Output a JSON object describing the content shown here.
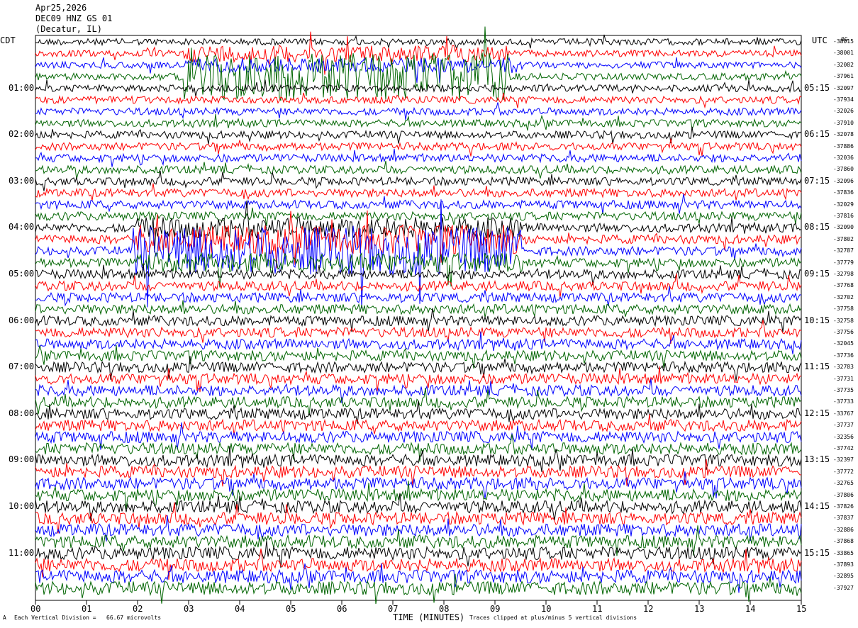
{
  "header": {
    "date": "Apr25,2026",
    "station": "DEC09 HNZ GS 01",
    "location": "(Decatur, IL)"
  },
  "left_tz": "CDT",
  "right_tz": "UTC",
  "right_tz_sub": "0G",
  "footer": {
    "scale": "Each Vertical Division =   66.67 microvolts",
    "clip": "Traces clipped at plus/minus 5 vertical divisions",
    "mark": "A"
  },
  "chart_data": {
    "type": "line",
    "title": "",
    "xlabel": "TIME (MINUTES)",
    "ylabel": "",
    "xlim": [
      0,
      15
    ],
    "x_ticks": [
      "00",
      "01",
      "02",
      "03",
      "04",
      "05",
      "06",
      "07",
      "08",
      "09",
      "10",
      "11",
      "12",
      "13",
      "14",
      "15"
    ],
    "left_labels": [
      "01:00",
      "02:00",
      "03:00",
      "04:00",
      "05:00",
      "06:00",
      "07:00",
      "08:00",
      "09:00",
      "10:00",
      "11:00"
    ],
    "right_labels": [
      "05:15",
      "06:15",
      "07:15",
      "08:15",
      "09:15",
      "10:15",
      "11:15",
      "12:15",
      "13:15",
      "14:15",
      "15:15"
    ],
    "trace_colors": [
      "#000000",
      "#ff0000",
      "#0000ff",
      "#006400"
    ],
    "trace_count": 48,
    "trace_offsets": [
      "-38015",
      "-38001",
      "-32082",
      "-37961",
      "-32097",
      "-37934",
      "-32026",
      "-37910",
      "-32078",
      "-37886",
      "-32036",
      "-37860",
      "-32096",
      "-37836",
      "-32029",
      "-37816",
      "-32090",
      "-37802",
      "-32787",
      "-37779",
      "-32798",
      "-37768",
      "-32702",
      "-37758",
      "-32758",
      "-37756",
      "-32045",
      "-37736",
      "-32783",
      "-37731",
      "-37735",
      "-37733",
      "-33767",
      "-37737",
      "-32356",
      "-37742",
      "-32397",
      "-37772",
      "-32765",
      "-37806",
      "-37826",
      "-37837",
      "-32886",
      "-37868",
      "-33865",
      "-37893",
      "-32895",
      "-37927"
    ],
    "events": [
      {
        "trace": 3,
        "from_min": 2.9,
        "to_min": 9.3,
        "amp": 1.0
      },
      {
        "trace": 1,
        "from_min": 2.9,
        "to_min": 9.3,
        "amp": 0.35
      },
      {
        "trace": 2,
        "from_min": 2.9,
        "to_min": 9.3,
        "amp": 0.3
      },
      {
        "trace": 18,
        "from_min": 1.9,
        "to_min": 9.5,
        "amp": 1.0
      },
      {
        "trace": 17,
        "from_min": 1.9,
        "to_min": 9.5,
        "amp": 0.6
      },
      {
        "trace": 16,
        "from_min": 1.9,
        "to_min": 9.5,
        "amp": 0.45
      },
      {
        "trace": 19,
        "from_min": 1.9,
        "to_min": 9.5,
        "amp": 0.4
      }
    ]
  }
}
